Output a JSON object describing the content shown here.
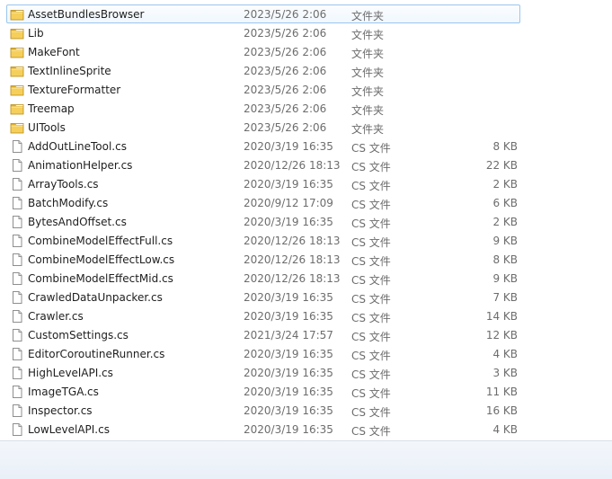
{
  "files": [
    {
      "name": "AssetBundlesBrowser",
      "date": "2023/5/26 2:06",
      "type": "文件夹",
      "size": "",
      "icon": "folder-icon",
      "focused": true
    },
    {
      "name": "Lib",
      "date": "2023/5/26 2:06",
      "type": "文件夹",
      "size": "",
      "icon": "folder-icon"
    },
    {
      "name": "MakeFont",
      "date": "2023/5/26 2:06",
      "type": "文件夹",
      "size": "",
      "icon": "folder-icon"
    },
    {
      "name": "TextInlineSprite",
      "date": "2023/5/26 2:06",
      "type": "文件夹",
      "size": "",
      "icon": "folder-icon"
    },
    {
      "name": "TextureFormatter",
      "date": "2023/5/26 2:06",
      "type": "文件夹",
      "size": "",
      "icon": "folder-icon"
    },
    {
      "name": "Treemap",
      "date": "2023/5/26 2:06",
      "type": "文件夹",
      "size": "",
      "icon": "folder-icon"
    },
    {
      "name": "UITools",
      "date": "2023/5/26 2:06",
      "type": "文件夹",
      "size": "",
      "icon": "folder-icon"
    },
    {
      "name": "AddOutLineTool.cs",
      "date": "2020/3/19 16:35",
      "type": "CS 文件",
      "size": "8 KB",
      "icon": "file-icon"
    },
    {
      "name": "AnimationHelper.cs",
      "date": "2020/12/26 18:13",
      "type": "CS 文件",
      "size": "22 KB",
      "icon": "file-icon"
    },
    {
      "name": "ArrayTools.cs",
      "date": "2020/3/19 16:35",
      "type": "CS 文件",
      "size": "2 KB",
      "icon": "file-icon"
    },
    {
      "name": "BatchModify.cs",
      "date": "2020/9/12 17:09",
      "type": "CS 文件",
      "size": "6 KB",
      "icon": "file-icon"
    },
    {
      "name": "BytesAndOffset.cs",
      "date": "2020/3/19 16:35",
      "type": "CS 文件",
      "size": "2 KB",
      "icon": "file-icon"
    },
    {
      "name": "CombineModelEffectFull.cs",
      "date": "2020/12/26 18:13",
      "type": "CS 文件",
      "size": "9 KB",
      "icon": "file-icon"
    },
    {
      "name": "CombineModelEffectLow.cs",
      "date": "2020/12/26 18:13",
      "type": "CS 文件",
      "size": "8 KB",
      "icon": "file-icon"
    },
    {
      "name": "CombineModelEffectMid.cs",
      "date": "2020/12/26 18:13",
      "type": "CS 文件",
      "size": "9 KB",
      "icon": "file-icon"
    },
    {
      "name": "CrawledDataUnpacker.cs",
      "date": "2020/3/19 16:35",
      "type": "CS 文件",
      "size": "7 KB",
      "icon": "file-icon"
    },
    {
      "name": "Crawler.cs",
      "date": "2020/3/19 16:35",
      "type": "CS 文件",
      "size": "14 KB",
      "icon": "file-icon"
    },
    {
      "name": "CustomSettings.cs",
      "date": "2021/3/24 17:57",
      "type": "CS 文件",
      "size": "12 KB",
      "icon": "file-icon"
    },
    {
      "name": "EditorCoroutineRunner.cs",
      "date": "2020/3/19 16:35",
      "type": "CS 文件",
      "size": "4 KB",
      "icon": "file-icon"
    },
    {
      "name": "HighLevelAPI.cs",
      "date": "2020/3/19 16:35",
      "type": "CS 文件",
      "size": "3 KB",
      "icon": "file-icon"
    },
    {
      "name": "ImageTGA.cs",
      "date": "2020/3/19 16:35",
      "type": "CS 文件",
      "size": "11 KB",
      "icon": "file-icon"
    },
    {
      "name": "Inspector.cs",
      "date": "2020/3/19 16:35",
      "type": "CS 文件",
      "size": "16 KB",
      "icon": "file-icon"
    },
    {
      "name": "LowLevelAPI.cs",
      "date": "2020/3/19 16:35",
      "type": "CS 文件",
      "size": "4 KB",
      "icon": "file-icon"
    }
  ]
}
